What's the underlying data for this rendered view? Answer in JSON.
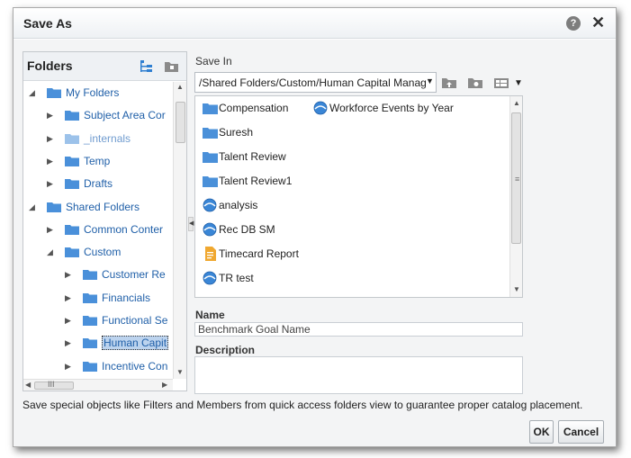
{
  "dialog": {
    "title": "Save As",
    "help_glyph": "?",
    "close_glyph": "✕"
  },
  "folders": {
    "title": "Folders",
    "tree": [
      {
        "label": "My Folders",
        "level": 0,
        "state": "expanded"
      },
      {
        "label": "Subject Area Cor",
        "level": 1,
        "state": "collapsed"
      },
      {
        "label": "_internals",
        "level": 1,
        "state": "collapsed",
        "dim": true
      },
      {
        "label": "Temp",
        "level": 1,
        "state": "collapsed"
      },
      {
        "label": "Drafts",
        "level": 1,
        "state": "collapsed"
      },
      {
        "label": "Shared Folders",
        "level": 0,
        "state": "expanded"
      },
      {
        "label": "Common Conter",
        "level": 1,
        "state": "collapsed"
      },
      {
        "label": "Custom",
        "level": 1,
        "state": "expanded"
      },
      {
        "label": "Customer Re",
        "level": 2,
        "state": "collapsed"
      },
      {
        "label": "Financials",
        "level": 2,
        "state": "collapsed"
      },
      {
        "label": "Functional Se",
        "level": 2,
        "state": "collapsed"
      },
      {
        "label": "Human Capit",
        "level": 2,
        "state": "collapsed",
        "selected": true
      },
      {
        "label": "Incentive Con",
        "level": 2,
        "state": "collapsed"
      }
    ],
    "hscroll_glyph": "III"
  },
  "save_in": {
    "label": "Save In",
    "path": "/Shared Folders/Custom/Human Capital Management"
  },
  "files": [
    {
      "name": "Compensation",
      "icon": "folder",
      "col": 0,
      "row": 0
    },
    {
      "name": "Workforce Events by Year",
      "icon": "analysis",
      "col": 1,
      "row": 0
    },
    {
      "name": "Suresh",
      "icon": "folder",
      "col": 0,
      "row": 1
    },
    {
      "name": "Talent Review",
      "icon": "folder",
      "col": 0,
      "row": 2
    },
    {
      "name": "Talent Review1",
      "icon": "folder",
      "col": 0,
      "row": 3
    },
    {
      "name": "analysis",
      "icon": "analysis",
      "col": 0,
      "row": 4
    },
    {
      "name": "Rec DB SM",
      "icon": "analysis",
      "col": 0,
      "row": 5
    },
    {
      "name": "Timecard Report",
      "icon": "report",
      "col": 0,
      "row": 6
    },
    {
      "name": "TR test",
      "icon": "analysis",
      "col": 0,
      "row": 7
    }
  ],
  "name_field": {
    "label": "Name",
    "value": "Benchmark Goal Name"
  },
  "description_field": {
    "label": "Description",
    "value": ""
  },
  "info": "Save special objects like Filters and Members from quick access folders view to guarantee proper catalog placement.",
  "buttons": {
    "ok": "OK",
    "cancel": "Cancel"
  },
  "colors": {
    "folder": "#4a90d9",
    "accent_text": "#1f5fa8",
    "report": "#f0a830"
  }
}
